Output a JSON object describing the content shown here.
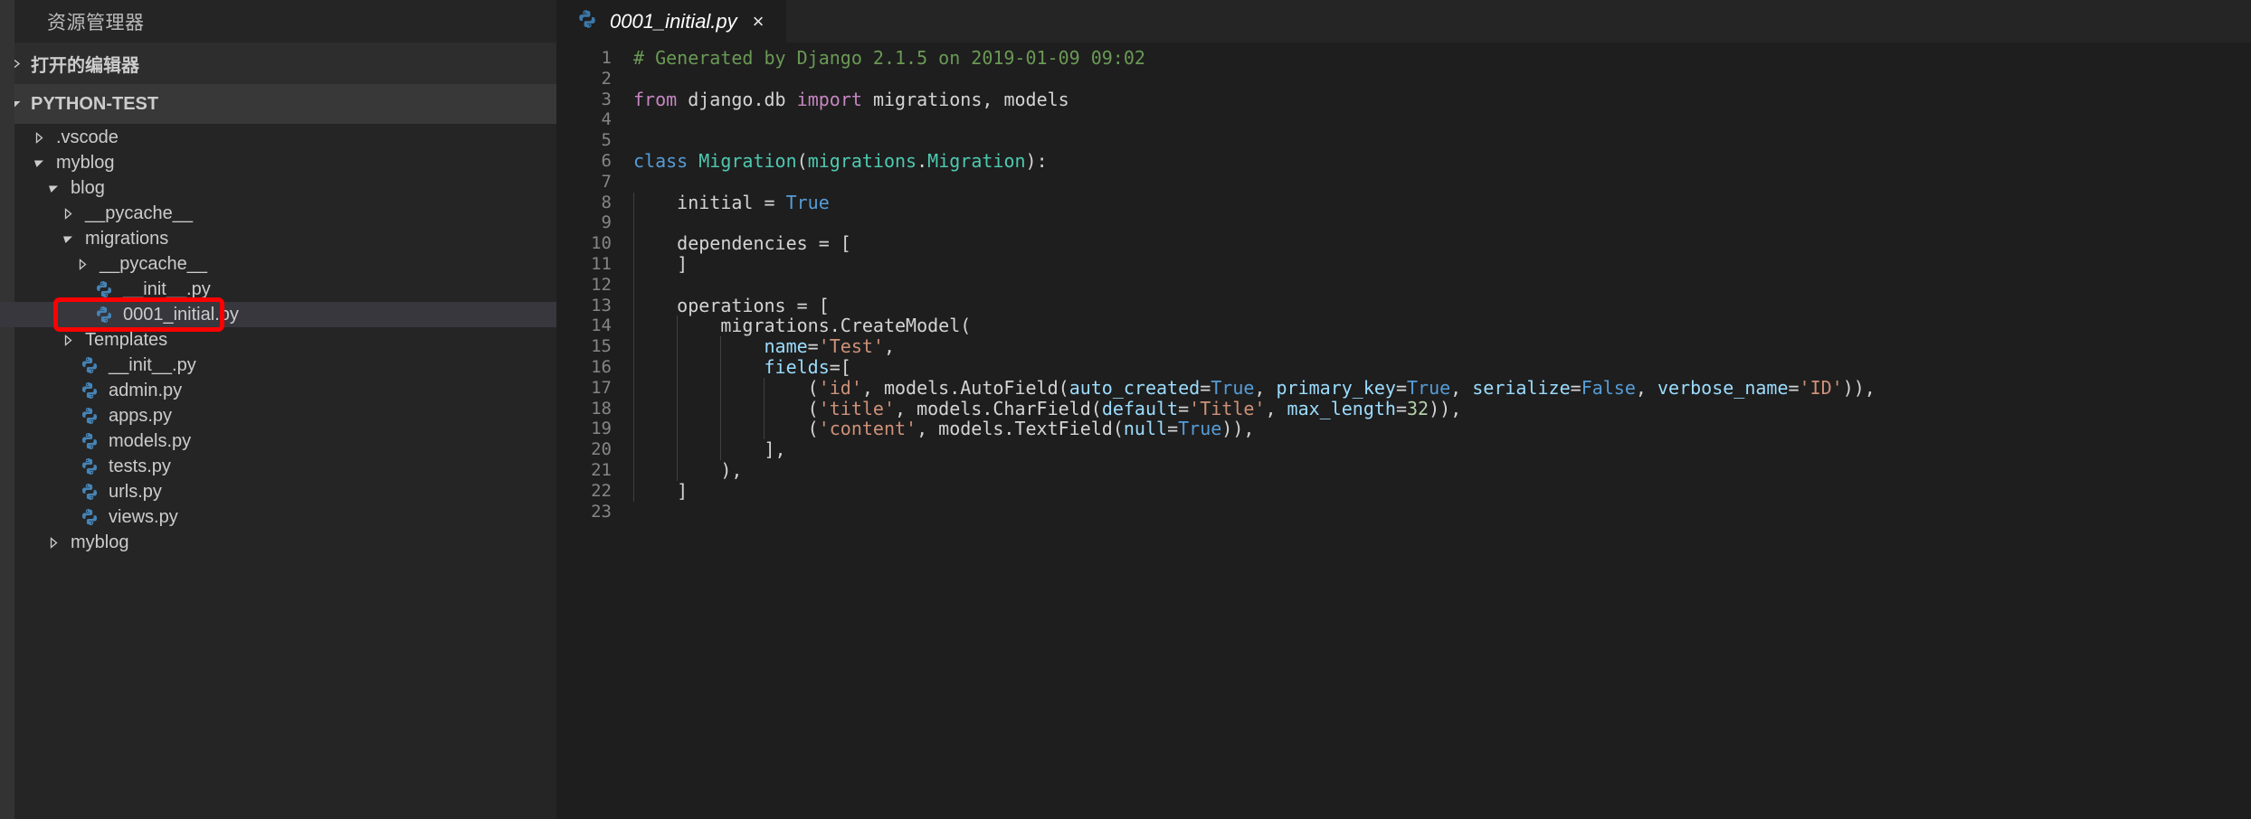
{
  "sidebar": {
    "title": "资源管理器",
    "sections": [
      {
        "label": "打开的编辑器",
        "expanded": false
      },
      {
        "label": "PYTHON-TEST",
        "expanded": true
      }
    ],
    "tree": [
      {
        "label": ".vscode",
        "indent": 1,
        "type": "folder",
        "expanded": false,
        "selected": false
      },
      {
        "label": "myblog",
        "indent": 1,
        "type": "folder",
        "expanded": true,
        "selected": false
      },
      {
        "label": "blog",
        "indent": 2,
        "type": "folder",
        "expanded": true,
        "selected": false
      },
      {
        "label": "__pycache__",
        "indent": 3,
        "type": "folder",
        "expanded": false,
        "selected": false
      },
      {
        "label": "migrations",
        "indent": 3,
        "type": "folder",
        "expanded": true,
        "selected": false
      },
      {
        "label": "__pycache__",
        "indent": 4,
        "type": "folder",
        "expanded": false,
        "selected": false
      },
      {
        "label": "__init__.py",
        "indent": 4,
        "type": "python",
        "expanded": false,
        "selected": false
      },
      {
        "label": "0001_initial.py",
        "indent": 4,
        "type": "python",
        "expanded": false,
        "selected": true
      },
      {
        "label": "Templates",
        "indent": 3,
        "type": "folder",
        "expanded": false,
        "selected": false
      },
      {
        "label": "__init__.py",
        "indent": 3,
        "type": "python",
        "expanded": false,
        "selected": false
      },
      {
        "label": "admin.py",
        "indent": 3,
        "type": "python",
        "expanded": false,
        "selected": false
      },
      {
        "label": "apps.py",
        "indent": 3,
        "type": "python",
        "expanded": false,
        "selected": false
      },
      {
        "label": "models.py",
        "indent": 3,
        "type": "python",
        "expanded": false,
        "selected": false
      },
      {
        "label": "tests.py",
        "indent": 3,
        "type": "python",
        "expanded": false,
        "selected": false
      },
      {
        "label": "urls.py",
        "indent": 3,
        "type": "python",
        "expanded": false,
        "selected": false
      },
      {
        "label": "views.py",
        "indent": 3,
        "type": "python",
        "expanded": false,
        "selected": false
      },
      {
        "label": "myblog",
        "indent": 2,
        "type": "folder",
        "expanded": false,
        "selected": false
      }
    ],
    "annotation": {
      "target": "0001_initial.py",
      "color": "#ff0000",
      "shape": "rounded-rectangle"
    }
  },
  "editor": {
    "tab": {
      "filename": "0001_initial.py",
      "icon": "python-icon",
      "close_label": "×",
      "preview_italic": true
    },
    "total_lines": 23,
    "line_numbers": [
      "1",
      "2",
      "3",
      "4",
      "5",
      "6",
      "7",
      "8",
      "9",
      "10",
      "11",
      "12",
      "13",
      "14",
      "15",
      "16",
      "17",
      "18",
      "19",
      "20",
      "21",
      "22",
      "23"
    ],
    "lines": [
      {
        "n": 1,
        "text": "# Generated by Django 2.1.5 on 2019-01-09 09:02"
      },
      {
        "n": 2,
        "text": ""
      },
      {
        "n": 3,
        "text": "from django.db import migrations, models"
      },
      {
        "n": 4,
        "text": ""
      },
      {
        "n": 5,
        "text": ""
      },
      {
        "n": 6,
        "text": "class Migration(migrations.Migration):"
      },
      {
        "n": 7,
        "text": ""
      },
      {
        "n": 8,
        "text": "    initial = True"
      },
      {
        "n": 9,
        "text": ""
      },
      {
        "n": 10,
        "text": "    dependencies = ["
      },
      {
        "n": 11,
        "text": "    ]"
      },
      {
        "n": 12,
        "text": ""
      },
      {
        "n": 13,
        "text": "    operations = ["
      },
      {
        "n": 14,
        "text": "        migrations.CreateModel("
      },
      {
        "n": 15,
        "text": "            name='Test',"
      },
      {
        "n": 16,
        "text": "            fields=["
      },
      {
        "n": 17,
        "text": "                ('id', models.AutoField(auto_created=True, primary_key=True, serialize=False, verbose_name='ID')),"
      },
      {
        "n": 18,
        "text": "                ('title', models.CharField(default='Title', max_length=32)),"
      },
      {
        "n": 19,
        "text": "                ('content', models.TextField(null=True)),"
      },
      {
        "n": 20,
        "text": "            ],"
      },
      {
        "n": 21,
        "text": "        ),"
      },
      {
        "n": 22,
        "text": "    ]"
      },
      {
        "n": 23,
        "text": ""
      }
    ]
  },
  "colors": {
    "sidebar_bg": "#252526",
    "sidebar_rail": "#333333",
    "section_active_bg": "#383838",
    "editor_bg": "#1e1e1e",
    "selected_row": "#37373d",
    "text": "#cccccc",
    "comment": "#6a9955",
    "keyword": "#c586c0",
    "control": "#569cd6",
    "class_name": "#4ec9b0",
    "string": "#ce9178",
    "param": "#9cdcfe",
    "number": "#b5cea8",
    "annotation_red": "#ff0000"
  }
}
